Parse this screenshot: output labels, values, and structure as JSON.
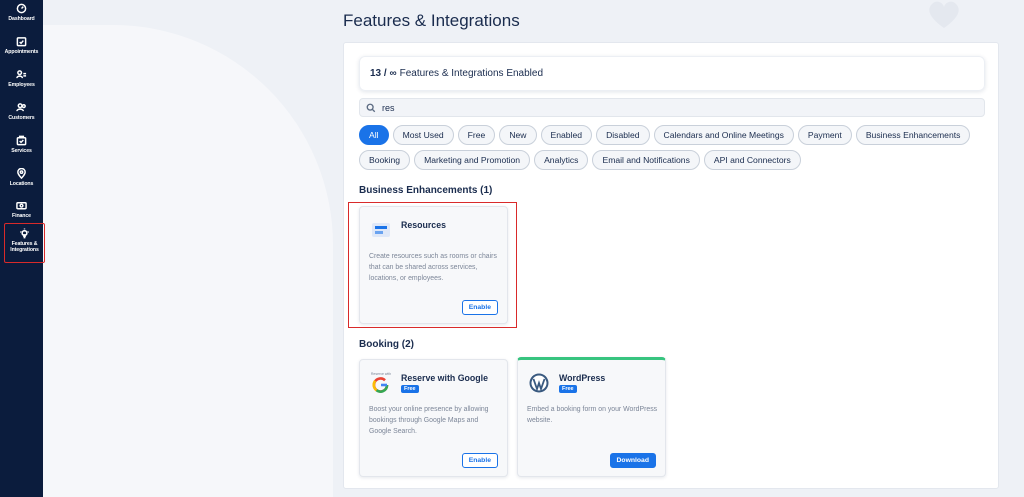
{
  "sidebar": {
    "items": [
      {
        "label": "Dashboard",
        "icon": "dashboard-icon"
      },
      {
        "label": "Appointments",
        "icon": "calendar-check-icon"
      },
      {
        "label": "Employees",
        "icon": "employees-icon"
      },
      {
        "label": "Customers",
        "icon": "customers-icon"
      },
      {
        "label": "Services",
        "icon": "services-icon"
      },
      {
        "label": "Locations",
        "icon": "location-pin-icon"
      },
      {
        "label": "Finance",
        "icon": "finance-icon"
      },
      {
        "label": "Features &",
        "label2": "Integrations",
        "icon": "lightbulb-icon",
        "active": true
      }
    ]
  },
  "page": {
    "title": "Features & Integrations"
  },
  "counter": {
    "count": "13 / ∞",
    "text": "Features & Integrations Enabled"
  },
  "search": {
    "value": "res"
  },
  "filters": {
    "row1": [
      "All",
      "Most Used",
      "Free",
      "New",
      "Enabled",
      "Disabled",
      "Calendars and Online Meetings",
      "Payment",
      "Business Enhancements"
    ],
    "row2": [
      "Booking",
      "Marketing and Promotion",
      "Analytics",
      "Email and Notifications",
      "API and Connectors"
    ],
    "active": "All"
  },
  "sections": {
    "business": {
      "title": "Business Enhancements (1)",
      "cards": [
        {
          "title": "Resources",
          "desc": "Create resources such as rooms or chairs that can be shared across services, locations, or employees.",
          "button": "Enable",
          "icon": "resources-icon"
        }
      ]
    },
    "booking": {
      "title": "Booking (2)",
      "cards": [
        {
          "title": "Reserve with Google",
          "badge": "Free",
          "desc": "Boost your online presence by allowing bookings through Google Maps and Google Search.",
          "button": "Enable",
          "icon": "google-icon",
          "icon_caption": "Reserve with"
        },
        {
          "title": "WordPress",
          "badge": "Free",
          "desc": "Embed a booking form on your WordPress website.",
          "button": "Download",
          "icon": "wordpress-icon"
        }
      ]
    }
  },
  "colors": {
    "sidebar": "#0b1c3d",
    "accent": "#1a73e8",
    "highlight": "#d92a2a",
    "green": "#37c47f"
  }
}
